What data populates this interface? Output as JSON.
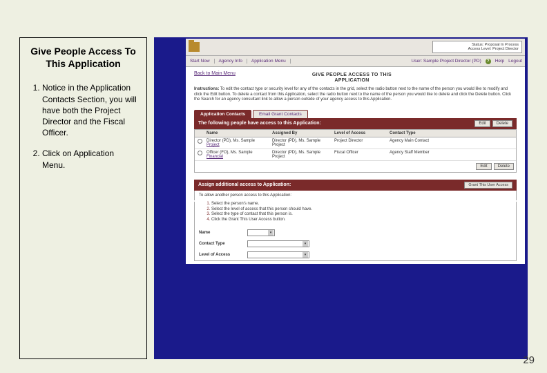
{
  "left": {
    "title": "Give People Access To This Application",
    "items": [
      "Notice in the Application Contacts Section, you will have both the Project Director and the Fiscal Officer.",
      "Click on Application Menu."
    ]
  },
  "app": {
    "status_line1": "Status: Proposal In Process",
    "status_line2": "Access Level: Project Director",
    "nav": {
      "start": "Start Now",
      "agency": "Agency Info",
      "appmenu": "Application Menu"
    },
    "user_label": "User: Sample Project Director (PD)",
    "help": "Help",
    "logout": "Logout",
    "back": "Back to Main Menu",
    "title_line1": "GIVE PEOPLE ACCESS TO THIS",
    "title_line2": "APPLICATION",
    "instructions_label": "Instructions:",
    "instructions": "To edit the contact type or security level for any of the contacts in the grid, select the radio button next to the name of the person you would like to modify and click the Edit button. To delete a contact from this Application, select the radio button next to the name of the person you would like to delete and click the Delete button. Click the Search for an agency consultant link to allow a person outside of your agency access to this Application.",
    "tabs": {
      "app_contacts": "Application Contacts",
      "email_contacts": "Email Grant Contacts"
    },
    "access_bar": "The following people have access to this Application:",
    "btn_edit": "Edit",
    "btn_delete": "Delete",
    "cols": {
      "name": "Name",
      "assigned": "Assigned By",
      "level": "Level of Access",
      "ctype": "Contact Type"
    },
    "rows": [
      {
        "name_role": "Director (PD), Ms. Sample",
        "name_link": "Project",
        "assigned": "Director (PD), Ms. Sample Project",
        "level": "Project Director",
        "ctype": "Agency Main Contact"
      },
      {
        "name_role": "Officer (FO), Ms. Sample",
        "name_link": "Financial",
        "assigned": "Director (PD), Ms. Sample Project",
        "level": "Fiscal Officer",
        "ctype": "Agency Staff Member"
      }
    ],
    "assign_bar": "Assign additional access to Application:",
    "grant_btn": "Grant This User Access",
    "assign_sub": "To allow another person access to this Application:",
    "steps": [
      "Select the person's name.",
      "Select the level of access that this person should have.",
      "Select the type of contact that this person is.",
      "Click the Grant This User Access button."
    ],
    "form": {
      "name": "Name",
      "ctype": "Contact Type",
      "level": "Level of Access"
    }
  },
  "page_num": "29"
}
